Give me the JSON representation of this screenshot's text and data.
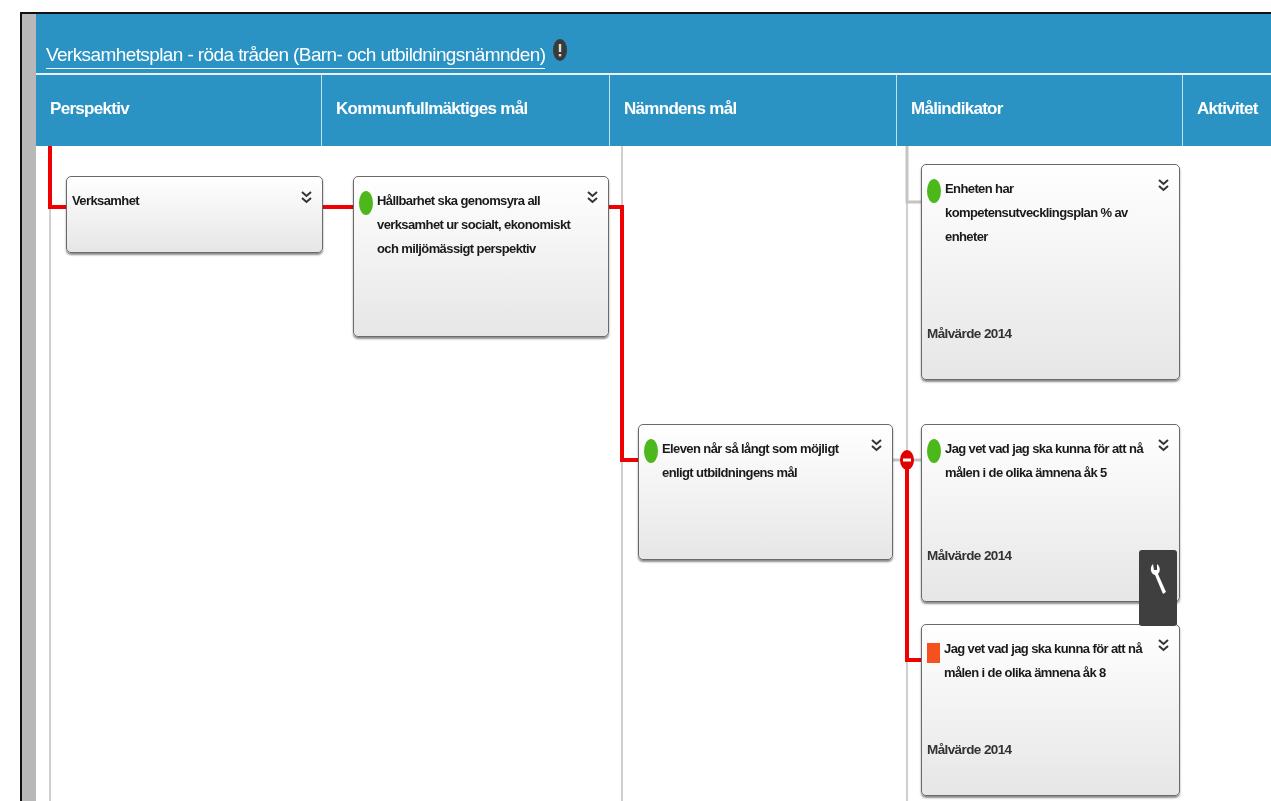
{
  "window": {
    "title": "Verksamhetsplan - röda tråden (Barn- och utbildningsnämnden)"
  },
  "columns": [
    "Perspektiv",
    "Kommunfullmäktiges mål",
    "Nämndens mål",
    "Målindikator",
    "Aktivitet"
  ],
  "cards": [
    {
      "kind": "none",
      "text": "Verksamhet",
      "on_path": true,
      "expanded": false
    },
    {
      "kind": "dot",
      "color": "#4cb81c",
      "text": "Hållbarhet ska genomsyra all verksamhet ur socialt, ekonomiskt och miljömässigt perspektiv",
      "on_path": true,
      "expanded": false
    },
    {
      "kind": "dot",
      "color": "#4cb81c",
      "text": "Enheten har kompetensutvecklingsplan % av enheter",
      "target": "Målvärde 2014",
      "on_path": false
    },
    {
      "kind": "dot",
      "color": "#4cb81c",
      "text": "Eleven når så långt som möjligt enligt utbildningens mål",
      "on_path": true,
      "expanded": true
    },
    {
      "kind": "dot",
      "color": "#4cb81c",
      "text": "Jag vet vad jag ska kunna för att nå målen  i de olika ämnena åk 5",
      "target": "Målvärde 2014",
      "on_path": false
    },
    {
      "kind": "square",
      "color": "#f4511e",
      "text": "Jag vet vad jag ska kunna för att nå målen i de olika ämnena åk 8",
      "target": "Målvärde 2014",
      "on_path": true
    }
  ]
}
